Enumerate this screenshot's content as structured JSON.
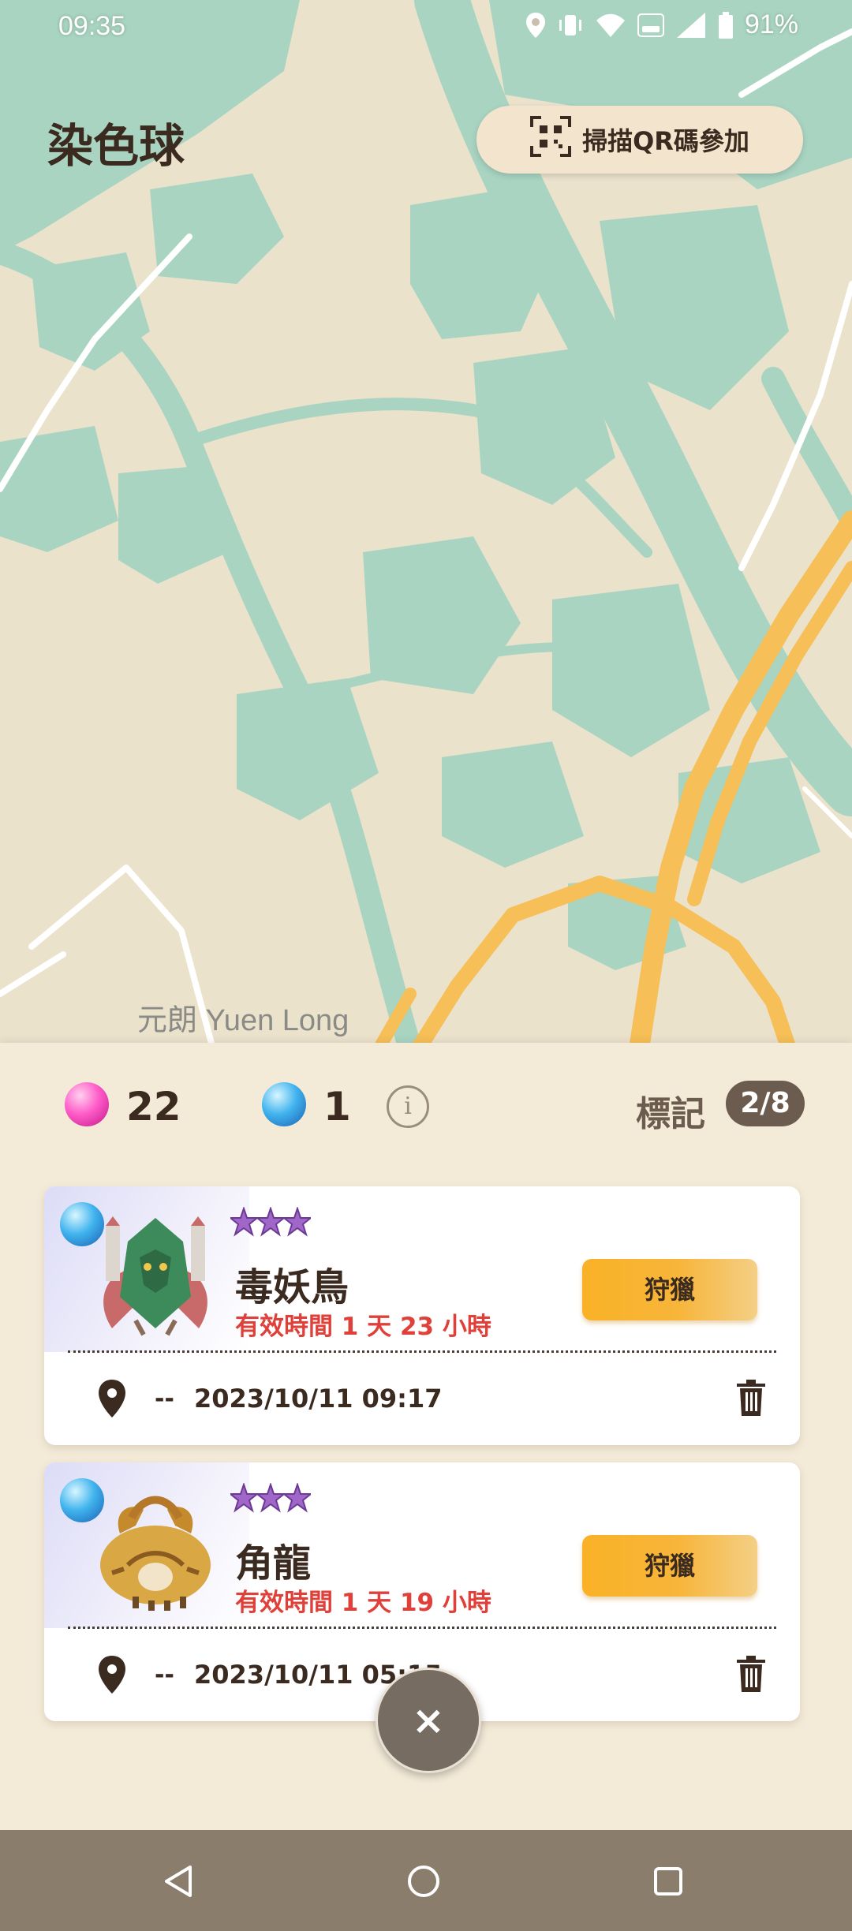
{
  "status_bar": {
    "time": "09:35",
    "battery": "91%"
  },
  "app": {
    "title": "染色球"
  },
  "scan_button": {
    "label": "掃描QR碼參加",
    "icon": "qr-code-icon"
  },
  "map": {
    "place_label": "元朗 Yuen Long"
  },
  "counters": {
    "pink_orbs": "22",
    "blue_orbs": "1",
    "info_icon": "info-icon"
  },
  "marks": {
    "label": "標記",
    "value": "2/8"
  },
  "cards": [
    {
      "orb_color": "#41b4ee",
      "stars": 3,
      "name": "毒妖鳥",
      "validity": "有效時間 1 天 23 小時",
      "hunt_label": "狩獵",
      "location": "--",
      "datetime": "2023/10/11 09:17",
      "monster_icon": "pukei-pukei-icon"
    },
    {
      "orb_color": "#41b4ee",
      "stars": 3,
      "name": "角龍",
      "validity": "有效時間 1 天 19 小時",
      "hunt_label": "狩獵",
      "location": "--",
      "datetime": "2023/10/11 05:15",
      "monster_icon": "diablos-icon"
    }
  ],
  "close_button": {
    "label": "×"
  },
  "colors": {
    "accent_orange": "#f9b227",
    "validity_red": "#e0403a",
    "panel_bg": "#f3ead8"
  }
}
